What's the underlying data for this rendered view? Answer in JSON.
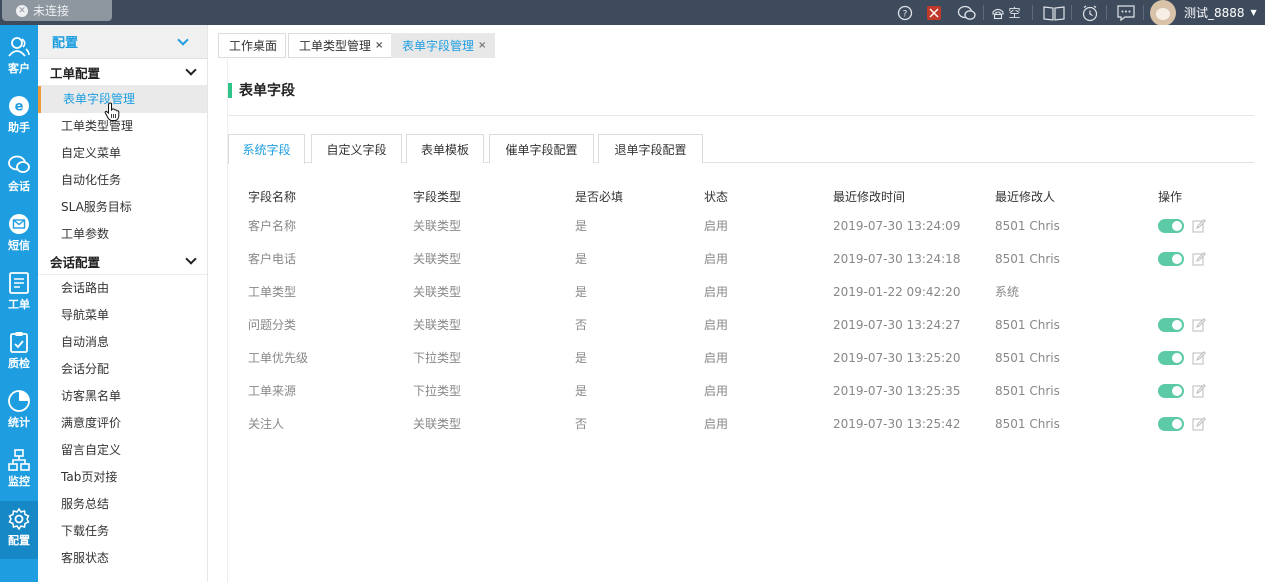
{
  "topbar": {
    "connection_status": "未连接",
    "phone_status": "空",
    "user_name": "测试_8888",
    "icons": [
      "help-icon",
      "vpn-icon",
      "chat-icon",
      "phone-icon",
      "book-icon",
      "clock-icon",
      "message-icon",
      "chevron-down-icon"
    ]
  },
  "rail": {
    "items": [
      {
        "label": "客户",
        "icon": "user-icon"
      },
      {
        "label": "助手",
        "icon": "e-icon"
      },
      {
        "label": "会话",
        "icon": "chat-icon"
      },
      {
        "label": "短信",
        "icon": "mail-icon"
      },
      {
        "label": "工单",
        "icon": "ticket-icon"
      },
      {
        "label": "质检",
        "icon": "clipboard-check-icon"
      },
      {
        "label": "统计",
        "icon": "pie-chart-icon"
      },
      {
        "label": "监控",
        "icon": "org-chart-icon"
      },
      {
        "label": "配置",
        "icon": "gear-icon"
      }
    ]
  },
  "menu": {
    "title": "配置",
    "group1": "工单配置",
    "group1_items": [
      "表单字段管理",
      "工单类型管理",
      "自定义菜单",
      "自动化任务",
      "SLA服务目标",
      "工单参数"
    ],
    "group2": "会话配置",
    "group2_items": [
      "会话路由",
      "导航菜单",
      "自动消息",
      "会话分配",
      "访客黑名单",
      "满意度评价",
      "留言自定义",
      "Tab页对接",
      "服务总结",
      "下载任务",
      "客服状态"
    ]
  },
  "page_tabs": [
    {
      "label": "工作桌面",
      "closable": false
    },
    {
      "label": "工单类型管理",
      "closable": true
    },
    {
      "label": "表单字段管理",
      "closable": true,
      "active": true
    }
  ],
  "close_glyph": "×",
  "panel": {
    "title": "表单字段",
    "subtabs": [
      "系统字段",
      "自定义字段",
      "表单模板",
      "催单字段配置",
      "退单字段配置"
    ],
    "columns": [
      "字段名称",
      "字段类型",
      "是否必填",
      "状态",
      "最近修改时间",
      "最近修改人",
      "操作"
    ],
    "rows": [
      {
        "name": "客户名称",
        "type": "关联类型",
        "required": "是",
        "status": "启用",
        "time": "2019-07-30 13:24:09",
        "by": "8501 Chris",
        "actions": true
      },
      {
        "name": "客户电话",
        "type": "关联类型",
        "required": "是",
        "status": "启用",
        "time": "2019-07-30 13:24:18",
        "by": "8501 Chris",
        "actions": true
      },
      {
        "name": "工单类型",
        "type": "关联类型",
        "required": "是",
        "status": "启用",
        "time": "2019-01-22 09:42:20",
        "by": "系统",
        "actions": false
      },
      {
        "name": "问题分类",
        "type": "关联类型",
        "required": "否",
        "status": "启用",
        "time": "2019-07-30 13:24:27",
        "by": "8501 Chris",
        "actions": true
      },
      {
        "name": "工单优先级",
        "type": "下拉类型",
        "required": "是",
        "status": "启用",
        "time": "2019-07-30 13:25:20",
        "by": "8501 Chris",
        "actions": true
      },
      {
        "name": "工单来源",
        "type": "下拉类型",
        "required": "是",
        "status": "启用",
        "time": "2019-07-30 13:25:35",
        "by": "8501 Chris",
        "actions": true
      },
      {
        "name": "关注人",
        "type": "关联类型",
        "required": "否",
        "status": "启用",
        "time": "2019-07-30 13:25:42",
        "by": "8501 Chris",
        "actions": true
      }
    ]
  },
  "colors": {
    "accent": "#1e9ee0",
    "rail": "#1e9ee0",
    "topbar": "#3d4b5c",
    "switch_on": "#5cc9a7",
    "title_bar": "#2fc58a",
    "active_marker": "#ef9b3a"
  }
}
